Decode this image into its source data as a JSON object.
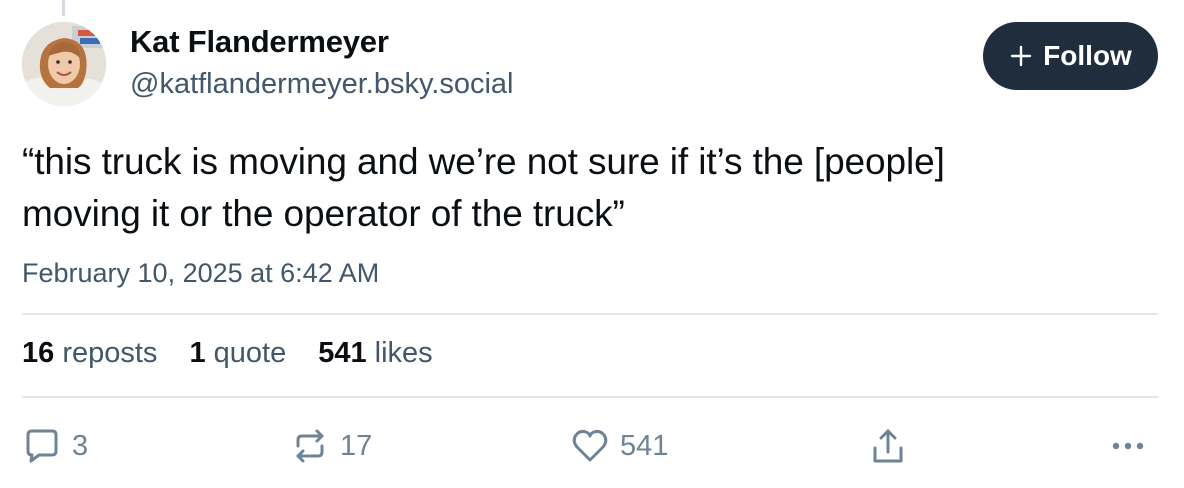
{
  "author": {
    "display_name": "Kat Flandermeyer",
    "handle": "@katflandermeyer.bsky.social",
    "avatar_icon": "user-avatar-photo"
  },
  "follow_button": {
    "label": "Follow",
    "icon": "plus-icon"
  },
  "post": {
    "line1": "“this truck is moving and we’re not sure if it’s the [people]",
    "line2": "moving it or the operator of the truck”",
    "timestamp": "February 10, 2025 at 6:42 AM"
  },
  "stats": {
    "reposts_count": "16",
    "reposts_label": "reposts",
    "quotes_count": "1",
    "quotes_label": "quote",
    "likes_count": "541",
    "likes_label": "likes"
  },
  "actions": {
    "reply_count": "3",
    "repost_count": "17",
    "like_count": "541"
  },
  "colors": {
    "text_primary": "#0b0f14",
    "text_secondary": "#42576c",
    "action_icon": "#6f8396",
    "follow_bg": "#1f2d3c",
    "divider": "#e3e7ec"
  }
}
